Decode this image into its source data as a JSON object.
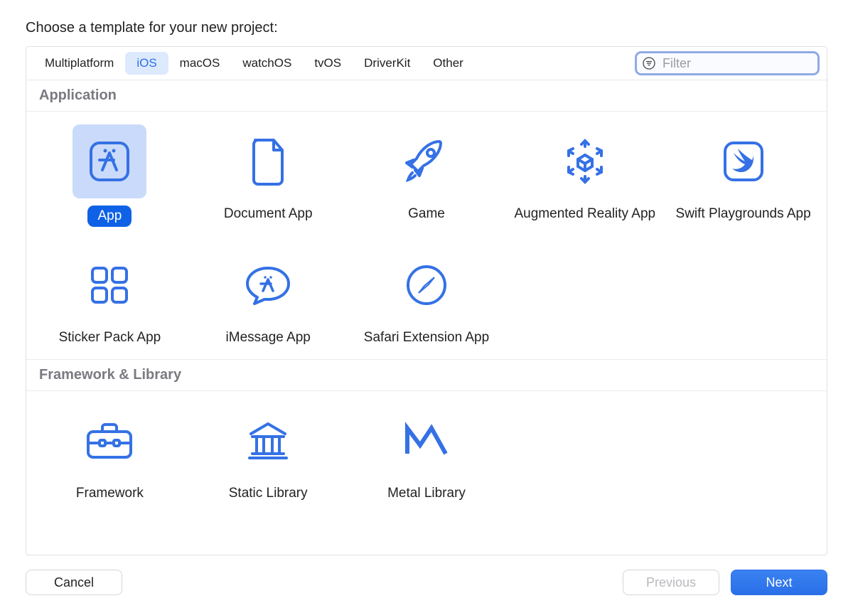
{
  "title": "Choose a template for your new project:",
  "tabs": [
    "Multiplatform",
    "iOS",
    "macOS",
    "watchOS",
    "tvOS",
    "DriverKit",
    "Other"
  ],
  "selected_tab_index": 1,
  "filter": {
    "placeholder": "Filter",
    "value": ""
  },
  "sections": {
    "application": {
      "title": "Application",
      "templates": [
        {
          "id": "app",
          "label": "App",
          "selected": true
        },
        {
          "id": "document-app",
          "label": "Document App",
          "selected": false
        },
        {
          "id": "game",
          "label": "Game",
          "selected": false
        },
        {
          "id": "ar-app",
          "label": "Augmented Reality App",
          "selected": false
        },
        {
          "id": "swift-playgrounds",
          "label": "Swift Playgrounds App",
          "selected": false
        },
        {
          "id": "sticker-pack",
          "label": "Sticker Pack App",
          "selected": false
        },
        {
          "id": "imessage-app",
          "label": "iMessage App",
          "selected": false
        },
        {
          "id": "safari-extension",
          "label": "Safari Extension App",
          "selected": false
        }
      ]
    },
    "framework": {
      "title": "Framework & Library",
      "templates": [
        {
          "id": "framework",
          "label": "Framework",
          "selected": false
        },
        {
          "id": "static-library",
          "label": "Static Library",
          "selected": false
        },
        {
          "id": "metal-library",
          "label": "Metal Library",
          "selected": false
        }
      ]
    }
  },
  "buttons": {
    "cancel": "Cancel",
    "previous": "Previous",
    "next": "Next"
  },
  "colors": {
    "accent": "#2a6fe8",
    "icon": "#3571e5",
    "focus_ring": "#8fa9e3"
  }
}
